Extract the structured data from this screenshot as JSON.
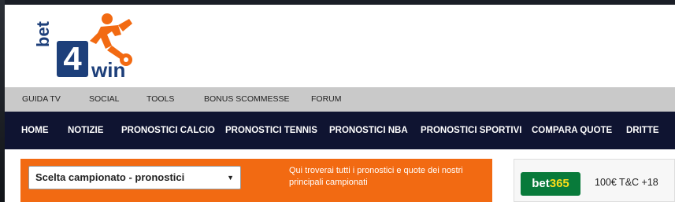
{
  "logo": {
    "bet": "bet",
    "four": "4",
    "win": "win"
  },
  "subnav": [
    {
      "label": "GUIDA TV"
    },
    {
      "label": "SOCIAL"
    },
    {
      "label": "TOOLS"
    },
    {
      "label": "BONUS SCOMMESSE"
    },
    {
      "label": "FORUM"
    }
  ],
  "mainnav": [
    {
      "label": "HOME"
    },
    {
      "label": "NOTIZIE"
    },
    {
      "label": "PRONOSTICI CALCIO"
    },
    {
      "label": "PRONOSTICI TENNIS"
    },
    {
      "label": "PRONOSTICI NBA"
    },
    {
      "label": "PRONOSTICI SPORTIVI"
    },
    {
      "label": "COMPARA QUOTE"
    },
    {
      "label": "DRITTE"
    }
  ],
  "championship_select": {
    "value": "Scelta campionato - pronostici"
  },
  "promo_text": "Qui troverai tutti i pronostici e quote dei nostri principali campionati",
  "sidebar_offer": {
    "brand_part1": "bet",
    "brand_part2": "365",
    "text": "100€ T&C +18"
  },
  "colors": {
    "orange": "#f26a12",
    "navy": "#0f1431",
    "subnav_gray": "#c9c9c9",
    "logo_blue": "#1d3f7a",
    "bet365_green": "#087a3a",
    "bet365_yellow": "#fdde19"
  }
}
